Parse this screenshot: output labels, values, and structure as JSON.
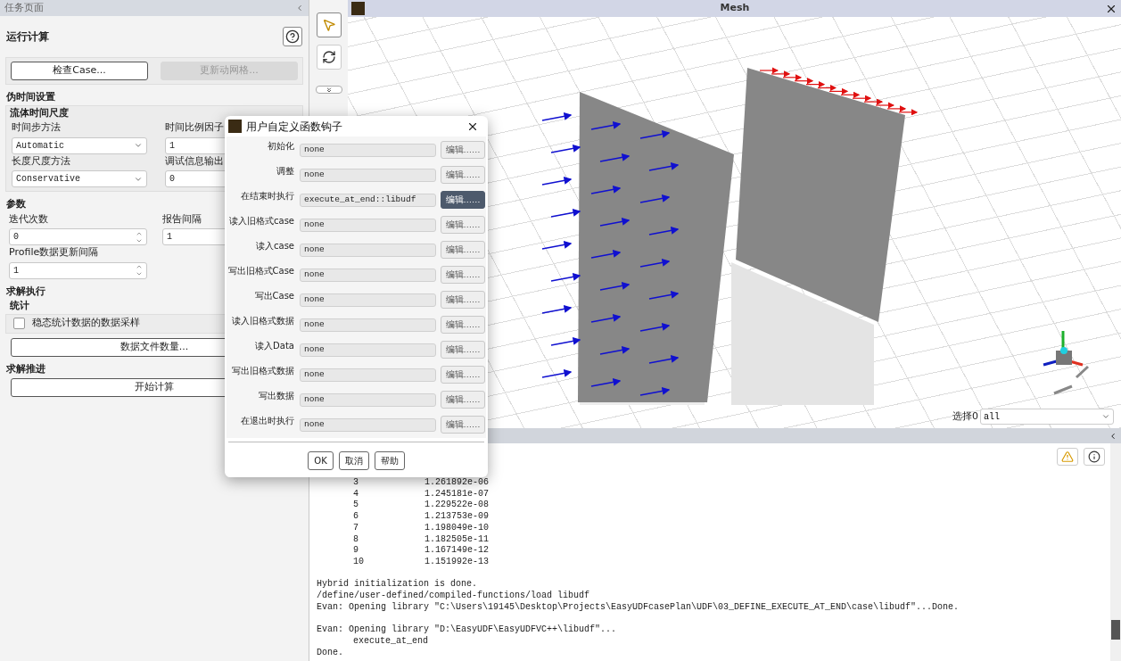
{
  "task_page": {
    "title": "任务页面",
    "heading": "运行计算",
    "top_buttons": [
      {
        "label": "检查Case...",
        "disabled": false
      },
      {
        "label": "更新动网格...",
        "disabled": true
      }
    ],
    "pseudo_time": {
      "title": "伪时间设置",
      "group": "流体时间尺度",
      "time_step_method": {
        "label": "时间步方法",
        "value": "Automatic"
      },
      "time_scale_factor": {
        "label": "时间比例因子",
        "value": "1"
      },
      "length_scale_method": {
        "label": "长度尺度方法",
        "value": "Conservative"
      },
      "verbosity": {
        "label": "调试信息输出",
        "value": "0"
      }
    },
    "parameters": {
      "title": "参数",
      "iterations": {
        "label": "迭代次数",
        "value": "0"
      },
      "report_interval": {
        "label": "报告间隔",
        "value": "1"
      },
      "profile_interval": {
        "label": "Profile数据更新间隔",
        "value": "1"
      }
    },
    "solution": {
      "title": "求解执行",
      "group": "统计",
      "checkbox": {
        "label": "稳态统计数据的数据采样",
        "checked": false
      },
      "button": "数据文件数量..."
    },
    "advance": {
      "title": "求解推进",
      "button": "开始计算"
    }
  },
  "graphics": {
    "title": "Mesh",
    "select_label": "选择0",
    "select_value": "all"
  },
  "console": {
    "residual_rows": [
      {
        "iter": "3",
        "value": "1.261892e-06"
      },
      {
        "iter": "4",
        "value": "1.245181e-07"
      },
      {
        "iter": "5",
        "value": "1.229522e-08"
      },
      {
        "iter": "6",
        "value": "1.213753e-09"
      },
      {
        "iter": "7",
        "value": "1.198049e-10"
      },
      {
        "iter": "8",
        "value": "1.182505e-11"
      },
      {
        "iter": "9",
        "value": "1.167149e-12"
      },
      {
        "iter": "10",
        "value": "1.151992e-13"
      }
    ],
    "blocks": [
      {
        "lines": [
          {
            "text": "Hybrid initialization is done.",
            "indent": false
          },
          {
            "text": "/define/user-defined/compiled-functions/load libudf",
            "indent": false
          },
          {
            "text": "Evan: Opening library \"C:\\Users\\19145\\Desktop\\Projects\\EasyUDFcasePlan\\UDF\\03_DEFINE_EXECUTE_AT_END\\case\\libudf\"...Done.",
            "indent": false
          }
        ]
      },
      {
        "lines": [
          {
            "text": "Evan: Opening library \"D:\\EasyUDF\\EasyUDFVC++\\libudf\"...",
            "indent": false
          },
          {
            "text": "execute_at_end",
            "indent": true
          },
          {
            "text": "Done.",
            "indent": false
          }
        ]
      }
    ]
  },
  "dialog": {
    "title": "用户自定义函数钩子",
    "rows": [
      {
        "label": "初始化",
        "value": "none",
        "button": "编辑……",
        "active": false
      },
      {
        "label": "调整",
        "value": "none",
        "button": "编辑……",
        "active": false
      },
      {
        "label": "在结束时执行",
        "value": "execute_at_end::libudf",
        "button": "编辑……",
        "active": true
      },
      {
        "label": "读入旧格式case",
        "value": "none",
        "button": "编辑……",
        "active": false
      },
      {
        "label": "读入case",
        "value": "none",
        "button": "编辑……",
        "active": false
      },
      {
        "label": "写出旧格式Case",
        "value": "none",
        "button": "编辑……",
        "active": false
      },
      {
        "label": "写出Case",
        "value": "none",
        "button": "编辑……",
        "active": false
      },
      {
        "label": "读入旧格式数据",
        "value": "none",
        "button": "编辑……",
        "active": false
      },
      {
        "label": "读入Data",
        "value": "none",
        "button": "编辑……",
        "active": false
      },
      {
        "label": "写出旧格式数据",
        "value": "none",
        "button": "编辑……",
        "active": false
      },
      {
        "label": "写出数据",
        "value": "none",
        "button": "编辑……",
        "active": false
      },
      {
        "label": "在退出时执行",
        "value": "none",
        "button": "编辑……",
        "active": false
      }
    ],
    "buttons": [
      "OK",
      "取消",
      "帮助"
    ]
  }
}
